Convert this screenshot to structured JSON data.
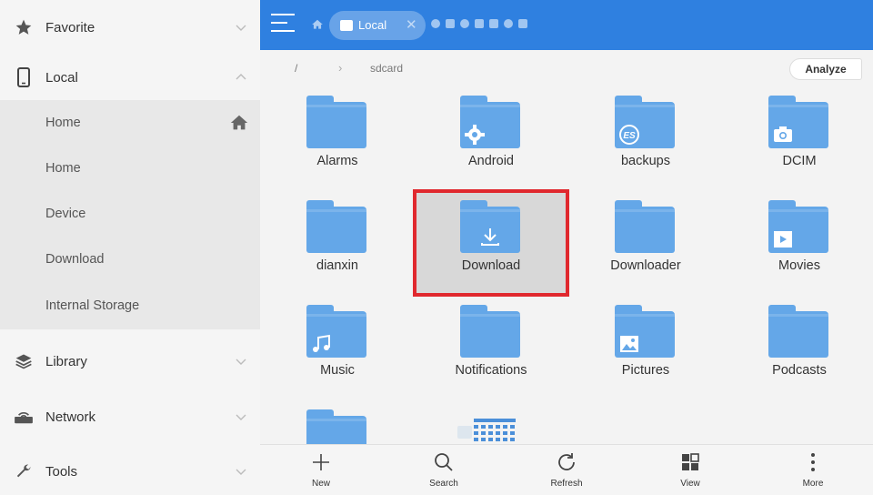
{
  "sidebar": {
    "sections": [
      {
        "label": "Favorite",
        "icon": "star-icon"
      },
      {
        "label": "Local",
        "icon": "phone-icon"
      },
      {
        "label": "Library",
        "icon": "layers-icon"
      },
      {
        "label": "Network",
        "icon": "router-icon"
      },
      {
        "label": "Tools",
        "icon": "wrench-icon"
      }
    ],
    "local_items": [
      {
        "label": "Home"
      },
      {
        "label": "Home"
      },
      {
        "label": "Device"
      },
      {
        "label": "Download"
      },
      {
        "label": "Internal Storage"
      }
    ]
  },
  "topbar": {
    "active_tab_label": "Local",
    "accent_color": "#2f80e0"
  },
  "breadcrumb": {
    "root": "/",
    "current": "sdcard"
  },
  "analyze_label": "Analyze",
  "folders": [
    {
      "name": "Alarms",
      "badge": ""
    },
    {
      "name": "Android",
      "badge": "gear-icon"
    },
    {
      "name": "backups",
      "badge": "es-logo-icon"
    },
    {
      "name": "DCIM",
      "badge": "camera-icon"
    },
    {
      "name": "dianxin",
      "badge": ""
    },
    {
      "name": "Download",
      "badge": "download-icon",
      "selected": true
    },
    {
      "name": "Downloader",
      "badge": ""
    },
    {
      "name": "Movies",
      "badge": "play-icon"
    },
    {
      "name": "Music",
      "badge": "music-note-icon"
    },
    {
      "name": "Notifications",
      "badge": ""
    },
    {
      "name": "Pictures",
      "badge": "image-icon"
    },
    {
      "name": "Podcasts",
      "badge": ""
    }
  ],
  "bottombar": {
    "new_label": "New",
    "search_label": "Search",
    "refresh_label": "Refresh",
    "view_label": "View",
    "more_label": "More"
  },
  "highlight_color": "#e0282e"
}
